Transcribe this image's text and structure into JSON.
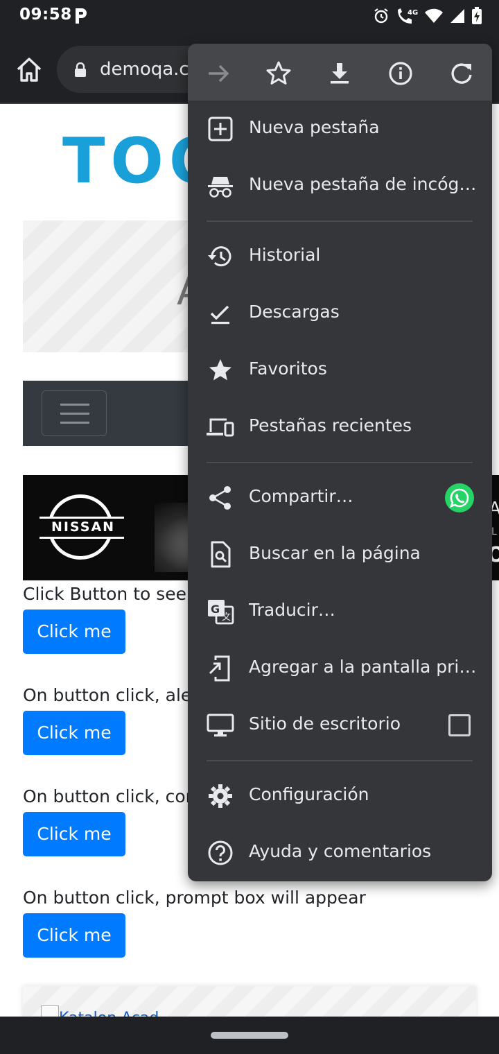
{
  "status_bar": {
    "time": "09:58",
    "network": "4G",
    "icons": [
      "parking-app-icon",
      "alarm-icon",
      "wifi-calling-icon",
      "wifi-icon",
      "cell-signal-icon",
      "battery-charging-icon"
    ]
  },
  "toolbar": {
    "url": "demoqa.com",
    "icons": [
      "home-icon",
      "lock-icon"
    ]
  },
  "page": {
    "logo_text": "TOO",
    "banner_letter": "A",
    "ad": {
      "brand": "NISSAN",
      "edge_letters": [
        "A",
        "L",
        "O"
      ]
    },
    "sections": [
      {
        "text": "Click Button to see a",
        "button": "Click me"
      },
      {
        "text": "On button click, aler",
        "button": "Click me"
      },
      {
        "text": "On button click, con",
        "button": "Click me"
      },
      {
        "text": "On button click, prompt box will appear",
        "button": "Click me"
      }
    ],
    "footer_link": "Katalon Acad"
  },
  "menu": {
    "top_icons": [
      "forward-icon",
      "bookmark-star-icon",
      "download-icon",
      "info-icon",
      "reload-icon"
    ],
    "items": [
      {
        "label": "Nueva pestaña",
        "icon": "new-tab-icon"
      },
      {
        "label": "Nueva pestaña de incógnito",
        "icon": "incognito-icon"
      },
      {
        "label": "Historial",
        "icon": "history-icon"
      },
      {
        "label": "Descargas",
        "icon": "downloads-icon"
      },
      {
        "label": "Favoritos",
        "icon": "bookmarks-icon"
      },
      {
        "label": "Pestañas recientes",
        "icon": "recent-tabs-icon"
      },
      {
        "label": "Compartir…",
        "icon": "share-icon",
        "extra": "whatsapp-icon"
      },
      {
        "label": "Buscar en la página",
        "icon": "find-in-page-icon"
      },
      {
        "label": "Traducir…",
        "icon": "translate-icon"
      },
      {
        "label": "Agregar a la pantalla principal",
        "icon": "add-to-home-icon"
      },
      {
        "label": "Sitio de escritorio",
        "icon": "desktop-site-icon",
        "checked": false
      },
      {
        "label": "Configuración",
        "icon": "settings-icon"
      },
      {
        "label": "Ayuda y comentarios",
        "icon": "help-icon"
      }
    ]
  },
  "colors": {
    "chrome_dark": "#202124",
    "menu_bg": "#35363a",
    "menu_top_bg": "#46474b",
    "button_blue": "#007bff",
    "whatsapp_green": "#25d366",
    "toolsqa_blue": "#1aa0d8"
  }
}
